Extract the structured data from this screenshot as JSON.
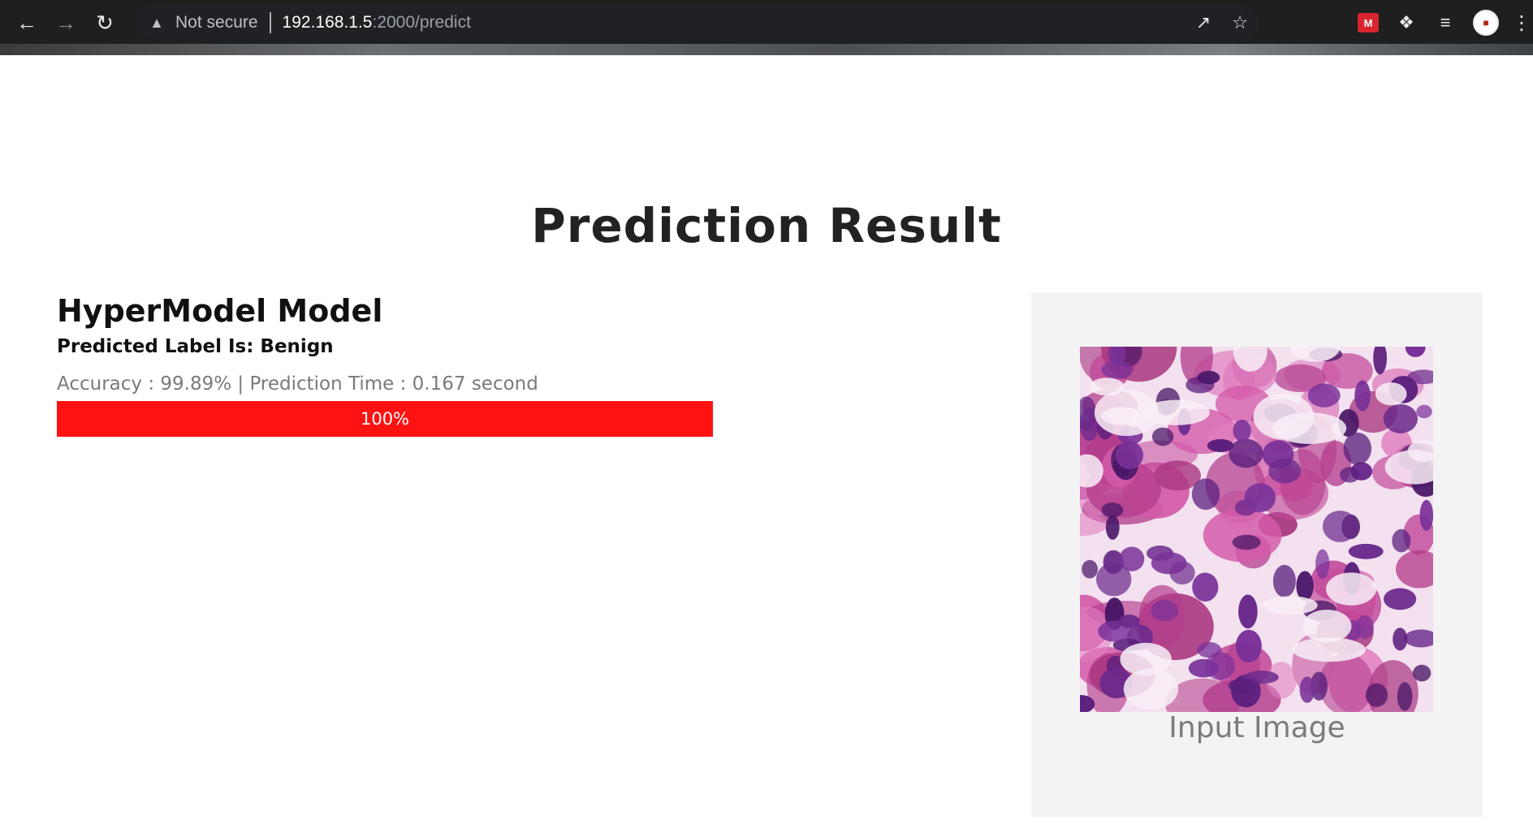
{
  "browser": {
    "back_icon": "arrow-left-icon",
    "forward_icon": "arrow-right-icon",
    "reload_icon": "reload-icon",
    "security_icon": "warning-triangle-icon",
    "security_label": "Not secure",
    "url_host": "192.168.1.5",
    "url_rest": ":2000/predict",
    "share_icon": "share-icon",
    "bookmark_icon": "star-icon",
    "extensions": [
      "red-extension-icon",
      "puzzle-extensions-icon",
      "media-playlist-icon"
    ],
    "avatar_icon": "profile-avatar-icon",
    "menu_icon": "kebab-menu-icon"
  },
  "page": {
    "title": "Prediction Result",
    "model_name": "HyperModel Model",
    "predicted_label": "Predicted Label Is: Benign",
    "metrics": "Accuracy : 99.89% | Prediction Time : 0.167 second",
    "progress": {
      "percent": 100,
      "label": "100%",
      "color": "#ff1212"
    },
    "image_caption": "Input Image"
  }
}
